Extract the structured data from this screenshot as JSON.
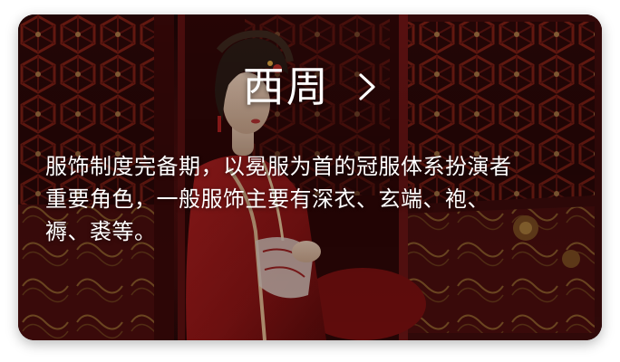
{
  "card": {
    "title": "西周",
    "chevron_icon": "chevron-right-icon",
    "description_lines": [
      "服饰制度完备期，以冕服为首的冠服体系扮演者",
      "重要角色，一般服饰主要有深衣、玄端、袍、",
      "褥、裘等。"
    ],
    "image_subject": "woman-in-red-hanfu-beside-carved-doors"
  },
  "colors": {
    "text": "#ffffff",
    "robe_red": "#8a1414",
    "wood_red": "#3d0b0b"
  }
}
